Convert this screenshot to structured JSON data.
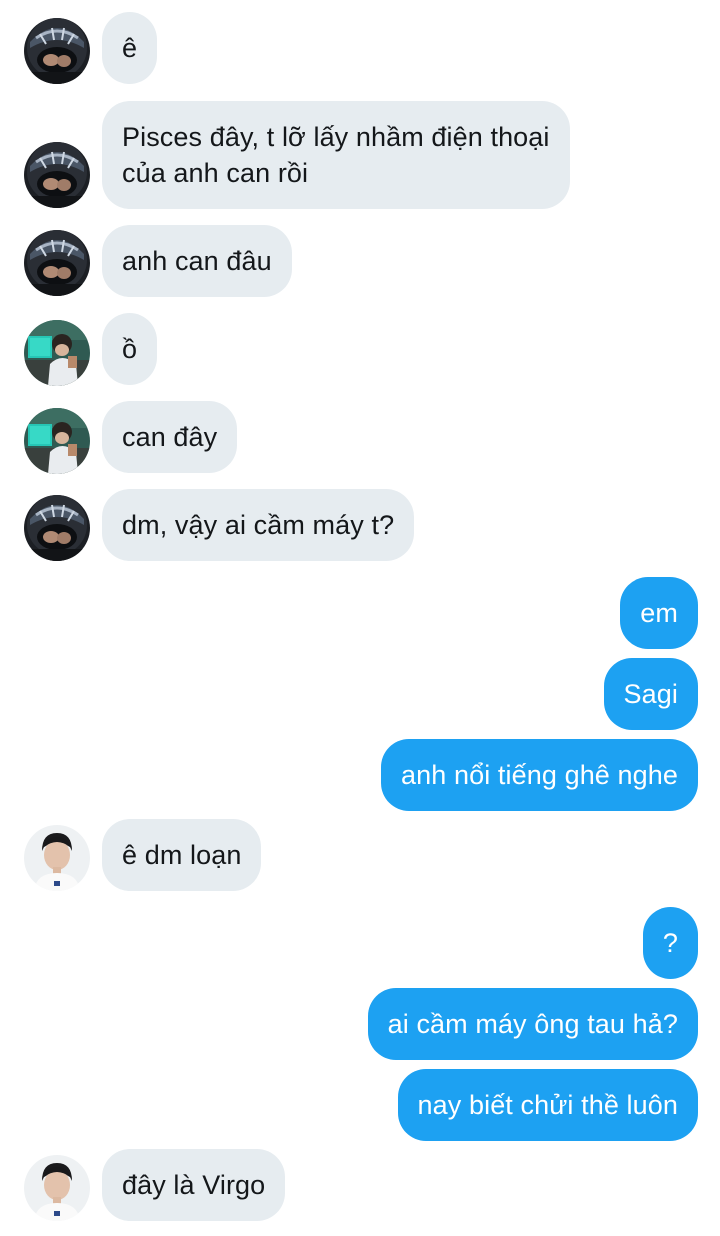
{
  "colors": {
    "incoming_bubble": "#e6ecf0",
    "outgoing_bubble": "#1da1f2",
    "incoming_text": "#14171a",
    "outgoing_text": "#ffffff"
  },
  "messages": [
    {
      "direction": "incoming",
      "sender_avatar": "helmet-avatar",
      "text": "ê"
    },
    {
      "direction": "incoming",
      "sender_avatar": "helmet-avatar",
      "text": "Pisces đây, t lỡ lấy nhầm điện thoại của anh can rồi"
    },
    {
      "direction": "incoming",
      "sender_avatar": "helmet-avatar",
      "text": "anh can đâu"
    },
    {
      "direction": "incoming",
      "sender_avatar": "gamer-avatar",
      "text": "ồ"
    },
    {
      "direction": "incoming",
      "sender_avatar": "gamer-avatar",
      "text": "can đây"
    },
    {
      "direction": "incoming",
      "sender_avatar": "helmet-avatar",
      "text": "dm, vậy ai cầm máy t?"
    },
    {
      "direction": "outgoing",
      "text": "em"
    },
    {
      "direction": "outgoing",
      "text": "Sagi"
    },
    {
      "direction": "outgoing",
      "text": "anh nổi tiếng ghê nghe"
    },
    {
      "direction": "incoming",
      "sender_avatar": "boy-avatar",
      "text": "ê dm loạn"
    },
    {
      "direction": "outgoing",
      "text": "?"
    },
    {
      "direction": "outgoing",
      "text": "ai cầm máy ông tau hả?"
    },
    {
      "direction": "outgoing",
      "text": "nay biết chửi thề luôn"
    },
    {
      "direction": "incoming",
      "sender_avatar": "boy-avatar",
      "text": "đây là Virgo"
    }
  ]
}
